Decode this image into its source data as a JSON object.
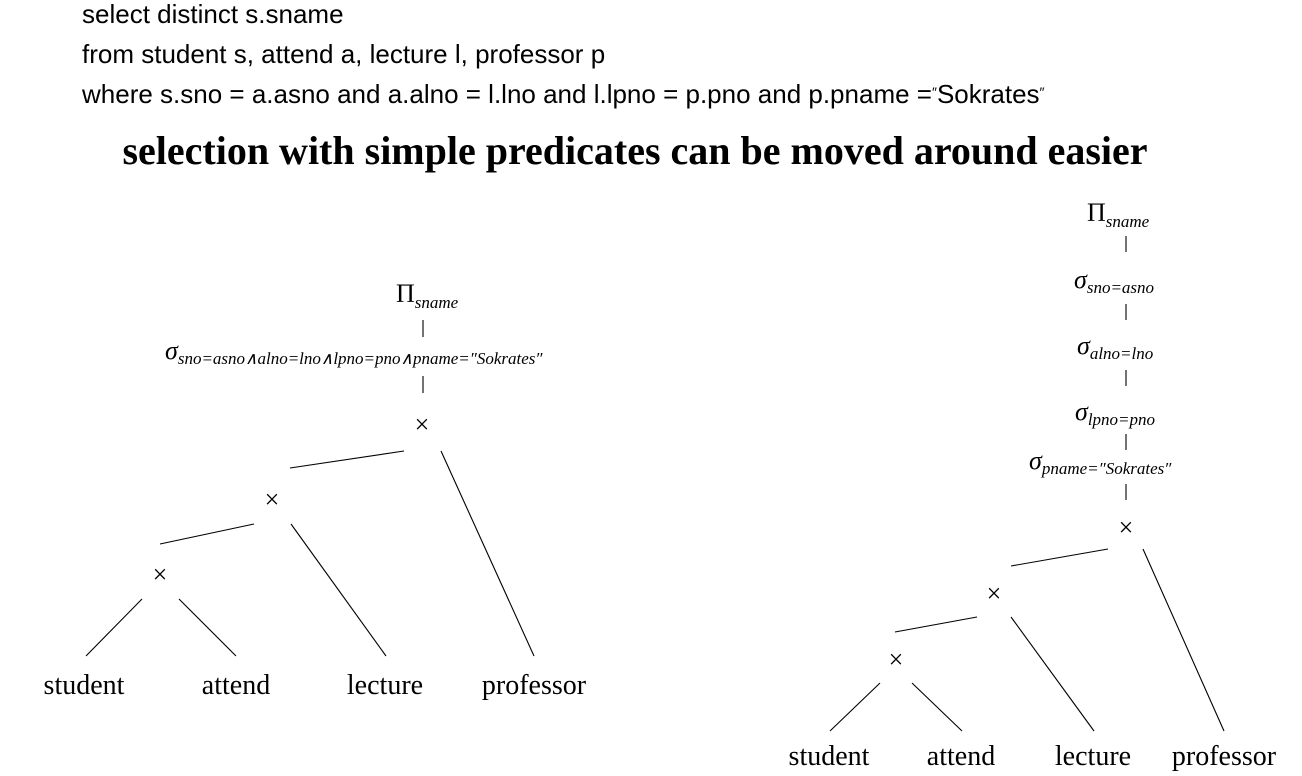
{
  "sql": {
    "line1": "select distinct s.sname",
    "line2": "from student s, attend a, lecture l, professor p",
    "line3_prefix": "where s.sno = a.asno and a.alno = l.lno and l.lpno = p.pno and p.pname =",
    "line3_literal": "Sokrates",
    "open_quote": "″",
    "close_quote": "″"
  },
  "headline": "selection with simple predicates can be moved around easier",
  "left_tree": {
    "projection": {
      "symbol": "Π",
      "subscript": "sname"
    },
    "selection": {
      "symbol": "σ",
      "subscript": "sno=asno∧alno=lno∧lpno=pno∧pname=″Sokrates″"
    },
    "cross": "×",
    "relations": [
      "student",
      "attend",
      "lecture",
      "professor"
    ]
  },
  "right_tree": {
    "projection": {
      "symbol": "Π",
      "subscript": "sname"
    },
    "selections": [
      {
        "symbol": "σ",
        "subscript": "sno=asno"
      },
      {
        "symbol": "σ",
        "subscript": "alno=lno"
      },
      {
        "symbol": "σ",
        "subscript": "lpno=pno"
      },
      {
        "symbol": "σ",
        "subscript": "pname=″Sokrates″"
      }
    ],
    "cross": "×",
    "relations": [
      "student",
      "attend",
      "lecture",
      "professor"
    ]
  }
}
